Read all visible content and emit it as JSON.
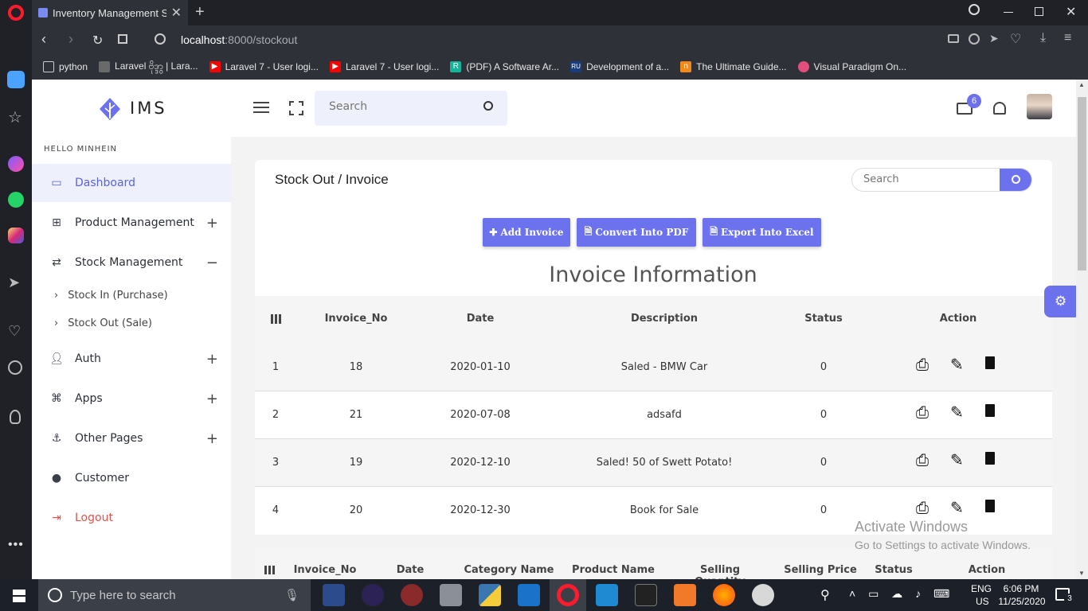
{
  "browser": {
    "tab_title": "Inventory Management Sys",
    "url_host": "localhost",
    "url_rest": ":8000/stockout",
    "bookmarks": [
      {
        "label": "python",
        "color": "#2e3238"
      },
      {
        "label": "Laravel ဗိုဒ္ဒွာ | Lara...",
        "color": "#6a6a6a"
      },
      {
        "label": "Laravel 7 - User logi...",
        "color": "#ff0000"
      },
      {
        "label": "Laravel 7 - User logi...",
        "color": "#ff0000"
      },
      {
        "label": "(PDF) A Software Ar...",
        "color": "#14b59a"
      },
      {
        "label": "Development of a...",
        "color": "#1a3d7c"
      },
      {
        "label": "The Ultimate Guide...",
        "color": "#f28a1a"
      },
      {
        "label": "Visual Paradigm On...",
        "color": "#e24f7f"
      }
    ]
  },
  "sidebar": {
    "logo": "IMS",
    "greeting": "HELLO MINHEIN",
    "items": [
      {
        "label": "Dashboard",
        "expander": ""
      },
      {
        "label": "Product Management",
        "expander": "+"
      },
      {
        "label": "Stock Management",
        "expander": "−"
      },
      {
        "label": "Auth",
        "expander": "+"
      },
      {
        "label": "Apps",
        "expander": "+"
      },
      {
        "label": "Other Pages",
        "expander": "+"
      },
      {
        "label": "Customer",
        "expander": ""
      },
      {
        "label": "Logout",
        "expander": ""
      }
    ],
    "sub_items": [
      "Stock In (Purchase)",
      "Stock Out (Sale)"
    ]
  },
  "topbar": {
    "search_placeholder": "Search",
    "mail_badge": "6"
  },
  "card": {
    "title": "Stock Out / Invoice",
    "search_placeholder": "Search",
    "buttons": {
      "add": "Add Invoice",
      "pdf": "Convert Into PDF",
      "excel": "Export Into Excel"
    },
    "heading": "Invoice Information",
    "columns": [
      "Invoice_No",
      "Date",
      "Description",
      "Status",
      "Action"
    ],
    "rows": [
      {
        "index": "1",
        "invoice_no": "18",
        "date": "2020-01-10",
        "description": "Saled - BMW Car",
        "status": "0"
      },
      {
        "index": "2",
        "invoice_no": "21",
        "date": "2020-07-08",
        "description": "adsafd",
        "status": "0"
      },
      {
        "index": "3",
        "invoice_no": "19",
        "date": "2020-12-10",
        "description": "Saled! 50 of Swett Potato!",
        "status": "0"
      },
      {
        "index": "4",
        "invoice_no": "20",
        "date": "2020-12-30",
        "description": "Book for Sale",
        "status": "0"
      }
    ],
    "second_table_columns": [
      "Invoice_No",
      "Date",
      "Category Name",
      "Product Name",
      "Selling Quantity",
      "Selling Price",
      "Status",
      "Action"
    ]
  },
  "watermark": {
    "line1": "Activate Windows",
    "line2": "Go to Settings to activate Windows."
  },
  "taskbar": {
    "search_placeholder": "Type here to search",
    "lang1": "ENG",
    "lang2": "US",
    "time": "6:06 PM",
    "date": "11/25/2020",
    "notifications": "3"
  },
  "colors": {
    "accent": "#6c72ee",
    "logout": "#e8504a",
    "dashboard_bg": "#eef0fc"
  }
}
